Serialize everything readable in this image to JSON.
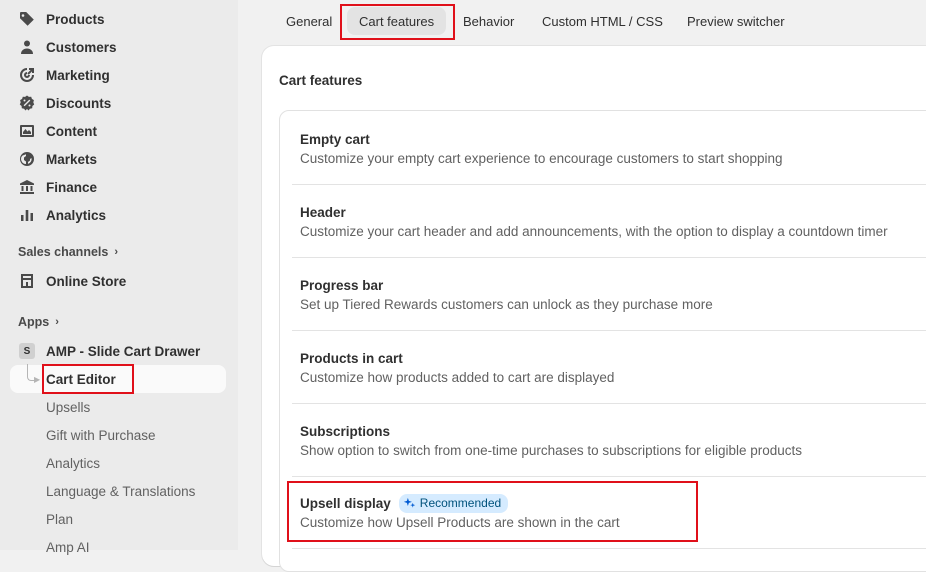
{
  "sidebar": {
    "nav": [
      {
        "label": "Products",
        "icon": "tag-icon"
      },
      {
        "label": "Customers",
        "icon": "person-icon"
      },
      {
        "label": "Marketing",
        "icon": "target-icon"
      },
      {
        "label": "Discounts",
        "icon": "discount-icon"
      },
      {
        "label": "Content",
        "icon": "content-icon"
      },
      {
        "label": "Markets",
        "icon": "globe-icon"
      },
      {
        "label": "Finance",
        "icon": "bank-icon"
      },
      {
        "label": "Analytics",
        "icon": "bar-chart-icon"
      }
    ],
    "sales_channels_label": "Sales channels",
    "online_store_label": "Online Store",
    "apps_label": "Apps",
    "app_badge": "S",
    "app_name": "AMP - Slide Cart Drawer",
    "app_items": [
      "Cart Editor",
      "Upsells",
      "Gift with Purchase",
      "Analytics",
      "Language & Translations",
      "Plan",
      "Amp AI"
    ]
  },
  "tabs": [
    "General",
    "Cart features",
    "Behavior",
    "Custom HTML / CSS",
    "Preview switcher"
  ],
  "selected_tab": "Cart features",
  "card": {
    "title": "Cart features",
    "features": [
      {
        "title": "Empty cart",
        "desc": "Customize your empty cart experience to encourage customers to start shopping"
      },
      {
        "title": "Header",
        "desc": "Customize your cart header and add announcements, with the option to display a countdown timer"
      },
      {
        "title": "Progress bar",
        "desc": "Set up Tiered Rewards customers can unlock as they purchase more"
      },
      {
        "title": "Products in cart",
        "desc": "Customize how products added to cart are displayed"
      },
      {
        "title": "Subscriptions",
        "desc": "Show option to switch from one-time purchases to subscriptions for eligible products"
      },
      {
        "title": "Upsell display",
        "desc": "Customize how Upsell Products are shown in the cart",
        "badge": "Recommended"
      }
    ]
  },
  "colors": {
    "highlight": "#e0101a",
    "badge_bg": "#d5ebff",
    "badge_text": "#00527c"
  }
}
